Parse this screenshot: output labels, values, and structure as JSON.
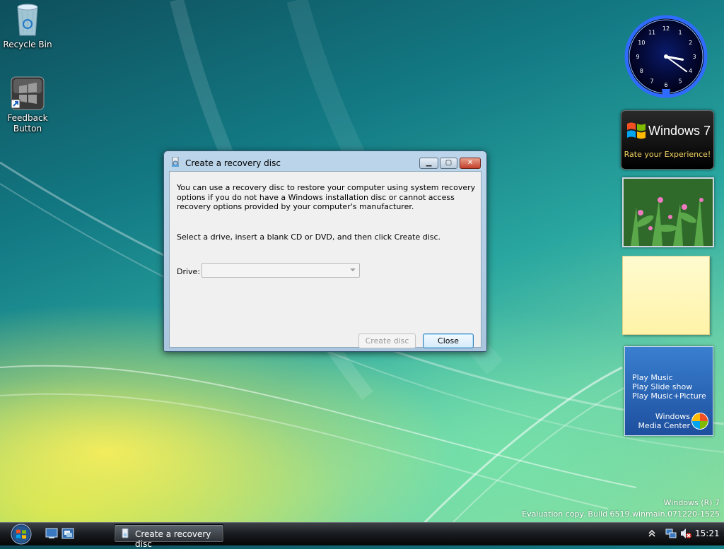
{
  "desktop": {
    "icons": [
      {
        "label": "Recycle Bin"
      },
      {
        "label": "Feedback Button"
      }
    ],
    "watermark": {
      "line1": "Windows (R) 7",
      "line2": "Evaluation copy. Build 6519.winmain.071220-1525"
    }
  },
  "gadgets": {
    "clock": {
      "hour": 3,
      "minute": 21,
      "numerals": [
        "12",
        "1",
        "2",
        "3",
        "4",
        "5",
        "6",
        "7",
        "8",
        "9",
        "10",
        "11"
      ]
    },
    "win7": {
      "title": "Windows 7",
      "subtitle": "Rate your Experience!"
    },
    "media_center": {
      "items": [
        "Play Music",
        "Play Slide show",
        "Play Music+Picture"
      ],
      "brand_line1": "Windows",
      "brand_line2": "Media Center"
    }
  },
  "dialog": {
    "title": "Create a recovery disc",
    "intro": "You can use a recovery disc to restore your computer using system recovery options if you do not have a Windows installation disc or cannot access recovery options provided by your computer's manufacturer.",
    "instruction": "Select a drive, insert a blank CD or DVD, and then click Create disc.",
    "drive_label": "Drive:",
    "drive_value": "",
    "create_label": "Create disc",
    "close_label": "Close"
  },
  "taskbar": {
    "task_label": "Create a recovery disc",
    "time": "15:21"
  },
  "colors": {
    "dialog_frame": "#a9c6de",
    "close_button": "#c4402c",
    "taskbar": "#1a1d21",
    "clock_glow": "#2f6bff",
    "note": "#fff3a8"
  }
}
